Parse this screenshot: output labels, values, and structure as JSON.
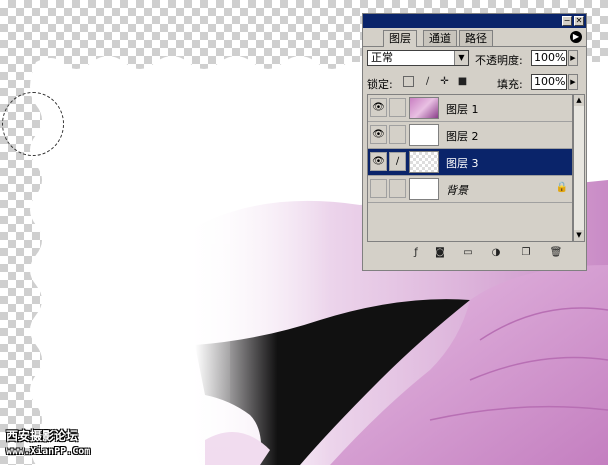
{
  "canvas": {
    "watermark_cn": "西安摄影论坛",
    "watermark_url": "www.XianPP.Com"
  },
  "palette": {
    "title": "",
    "tabs": [
      {
        "label": "图层",
        "active": true
      },
      {
        "label": "通道",
        "active": false
      },
      {
        "label": "路径",
        "active": false
      }
    ],
    "blend_mode": "正常",
    "opacity_label": "不透明度:",
    "opacity_value": "100%",
    "lock_label": "锁定:",
    "lock_icons": [
      "lock-transparent-icon",
      "lock-brush-icon",
      "lock-move-icon",
      "lock-all-icon"
    ],
    "fill_label": "填充:",
    "fill_value": "100%",
    "layers": [
      {
        "name": "图层 1",
        "visible": true,
        "linked": false,
        "thumb": "flower",
        "selected": false
      },
      {
        "name": "图层 2",
        "visible": true,
        "linked": false,
        "thumb": "white",
        "selected": false
      },
      {
        "name": "图层 3",
        "visible": true,
        "linked": true,
        "thumb": "transparent",
        "selected": true
      },
      {
        "name": "背景",
        "visible": false,
        "linked": false,
        "thumb": "white",
        "selected": false,
        "locked": true
      }
    ],
    "bottom_icons": [
      "layer-style-icon",
      "layer-mask-icon",
      "new-group-icon",
      "adjustment-layer-icon",
      "new-layer-icon",
      "delete-layer-icon"
    ],
    "colors": {
      "titlebar": "#0a246a",
      "selected_row": "#0a246a",
      "panel_bg": "#d4d0c8"
    }
  }
}
